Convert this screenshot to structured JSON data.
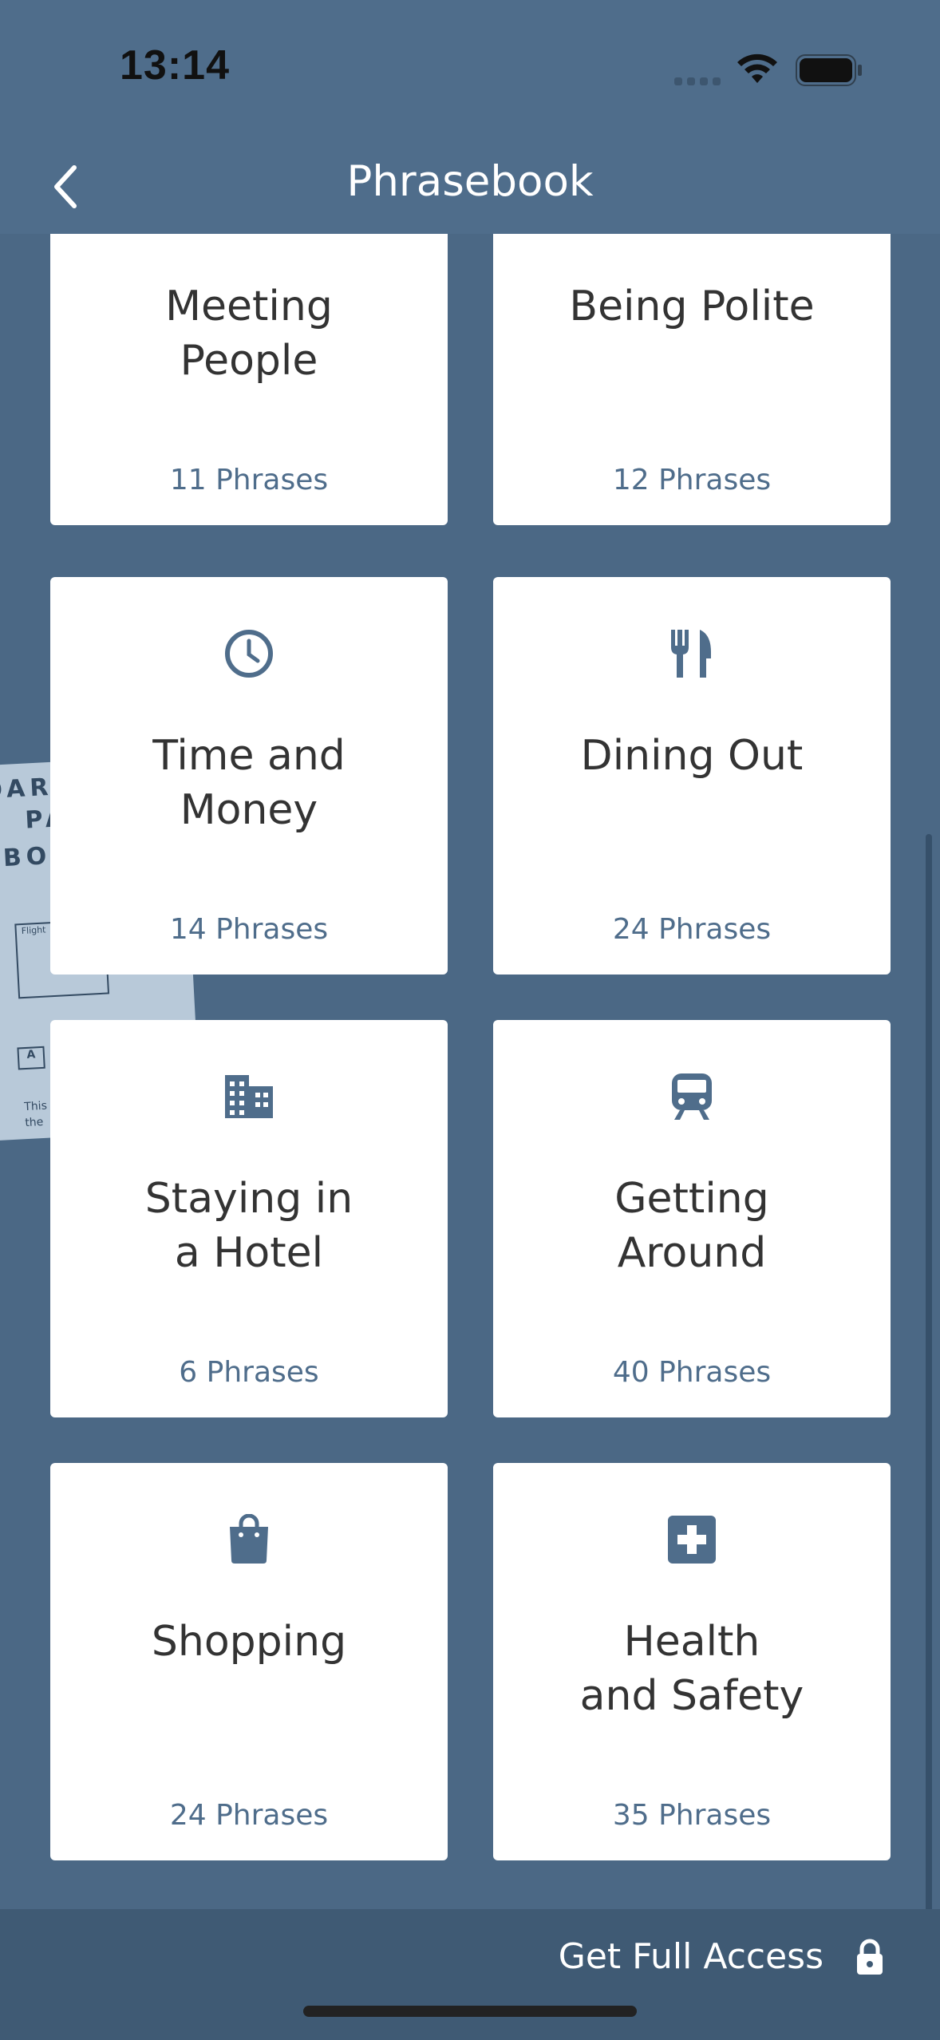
{
  "status_bar": {
    "time": "13:14"
  },
  "nav": {
    "title": "Phrasebook",
    "back_icon": "chevron-left-icon"
  },
  "decor": {
    "boarding_pass": {
      "line1": "OARDING",
      "line2": "PASS",
      "line3": "BO",
      "label": "Flight",
      "seat": "A",
      "text": "This\nthe"
    }
  },
  "categories": [
    {
      "title": "Meeting\nPeople",
      "count": "11 Phrases",
      "icon": ""
    },
    {
      "title": "Being Polite",
      "count": "12 Phrases",
      "icon": ""
    },
    {
      "title": "Time and\nMoney",
      "count": "14 Phrases",
      "icon": "clock-icon"
    },
    {
      "title": "Dining Out",
      "count": "24 Phrases",
      "icon": "fork-knife-icon"
    },
    {
      "title": "Staying in\na Hotel",
      "count": "6 Phrases",
      "icon": "building-icon"
    },
    {
      "title": "Getting\nAround",
      "count": "40 Phrases",
      "icon": "train-icon"
    },
    {
      "title": "Shopping",
      "count": "24 Phrases",
      "icon": "shopping-bag-icon"
    },
    {
      "title": "Health\nand Safety",
      "count": "35 Phrases",
      "icon": "medical-cross-icon"
    }
  ],
  "footer": {
    "cta_label": "Get Full Access",
    "cta_icon": "lock-icon"
  },
  "colors": {
    "accent": "#4f6d8b",
    "background": "#4b6885",
    "card": "#ffffff"
  }
}
